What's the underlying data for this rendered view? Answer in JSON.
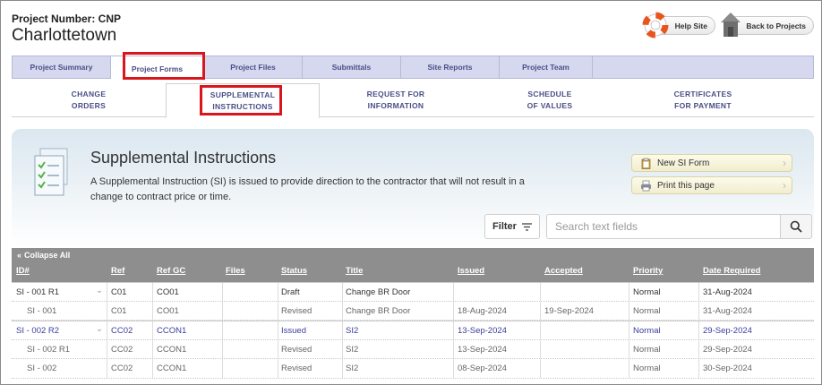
{
  "header": {
    "project_number": "Project Number: CNP",
    "project_name": "Charlottetown",
    "help_label": "Help Site",
    "back_label": "Back to Projects"
  },
  "tabs": [
    "Project Summary",
    "Project Forms",
    "Project Files",
    "Submittals",
    "Site Reports",
    "Project Team"
  ],
  "subtabs": [
    [
      "CHANGE",
      "ORDERS"
    ],
    [
      "SUPPLEMENTAL",
      "INSTRUCTIONS"
    ],
    [
      "REQUEST FOR",
      "INFORMATION"
    ],
    [
      "SCHEDULE",
      "OF VALUES"
    ],
    [
      "CERTIFICATES",
      "FOR PAYMENT"
    ]
  ],
  "panel": {
    "title": "Supplemental Instructions",
    "description": "A Supplemental Instruction (SI) is issued to provide direction to the contractor that will not result in a change to contract price or time.",
    "new_form": "New SI Form",
    "print": "Print this page"
  },
  "toolbar": {
    "filter_label": "Filter",
    "search_placeholder": "Search text fields"
  },
  "table": {
    "collapse_label": "Collapse All",
    "columns": [
      "ID#",
      "Ref",
      "Ref GC",
      "Files",
      "Status",
      "Title",
      "Issued",
      "Accepted",
      "Priority",
      "Date Required"
    ],
    "rows": [
      {
        "id": "SI - 001 R1",
        "ref": "C01",
        "refgc": "CO01",
        "files": "",
        "status": "Draft",
        "title": "Change BR Door",
        "issued": "",
        "accepted": "",
        "priority": "Normal",
        "date": "31-Aug-2024"
      },
      {
        "id": "SI - 001",
        "ref": "C01",
        "refgc": "CO01",
        "files": "",
        "status": "Revised",
        "title": "Change BR Door",
        "issued": "18-Aug-2024",
        "accepted": "19-Sep-2024",
        "priority": "Normal",
        "date": "31-Aug-2024"
      },
      {
        "id": "SI - 002 R2",
        "ref": "CC02",
        "refgc": "CCON1",
        "files": "",
        "status": "Issued",
        "title": "SI2",
        "issued": "13-Sep-2024",
        "accepted": "",
        "priority": "Normal",
        "date": "29-Sep-2024"
      },
      {
        "id": "SI - 002 R1",
        "ref": "CC02",
        "refgc": "CCON1",
        "files": "",
        "status": "Revised",
        "title": "SI2",
        "issued": "13-Sep-2024",
        "accepted": "",
        "priority": "Normal",
        "date": "29-Sep-2024"
      },
      {
        "id": "SI - 002",
        "ref": "CC02",
        "refgc": "CCON1",
        "files": "",
        "status": "Revised",
        "title": "SI2",
        "issued": "08-Sep-2024",
        "accepted": "",
        "priority": "Normal",
        "date": "30-Sep-2024"
      }
    ]
  },
  "colors": {
    "tab_bg": "#d6d8ef",
    "tab_text": "#4a4e86",
    "highlight": "#d9161c",
    "table_header": "#8e8e8e",
    "link_blue": "#3a3e9a"
  }
}
